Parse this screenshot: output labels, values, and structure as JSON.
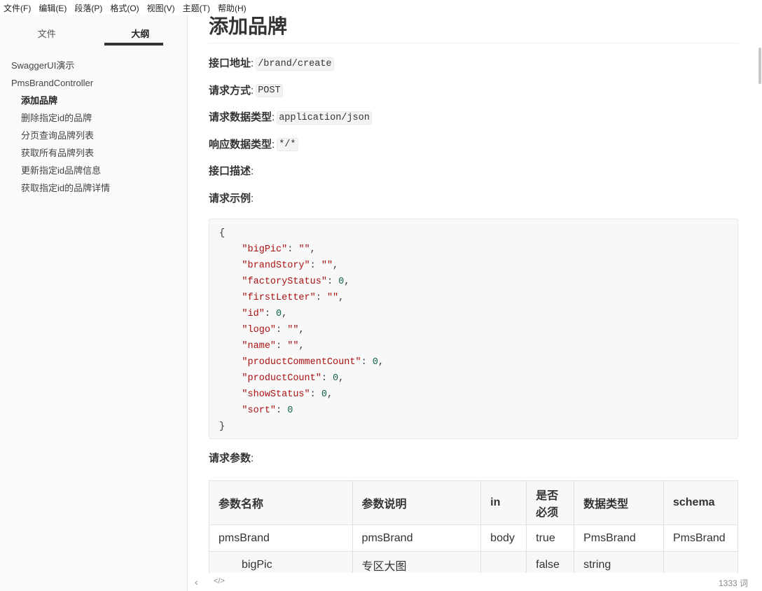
{
  "menu": [
    "文件(F)",
    "编辑(E)",
    "段落(P)",
    "格式(O)",
    "视图(V)",
    "主题(T)",
    "帮助(H)"
  ],
  "sidebar": {
    "tabs": [
      "文件",
      "大纲"
    ],
    "outline": [
      {
        "label": "SwaggerUI演示",
        "level": 1
      },
      {
        "label": "PmsBrandController",
        "level": 1
      },
      {
        "label": "添加品牌",
        "level": 2,
        "active": true
      },
      {
        "label": "删除指定id的品牌",
        "level": 2
      },
      {
        "label": "分页查询品牌列表",
        "level": 2
      },
      {
        "label": "获取所有品牌列表",
        "level": 2
      },
      {
        "label": "更新指定id品牌信息",
        "level": 2
      },
      {
        "label": "获取指定id的品牌详情",
        "level": 2
      }
    ]
  },
  "doc": {
    "title": "添加品牌",
    "fields": [
      {
        "label": "接口地址",
        "code": "/brand/create"
      },
      {
        "label": "请求方式",
        "code": "POST"
      },
      {
        "label": "请求数据类型",
        "code": "application/json"
      },
      {
        "label": "响应数据类型",
        "code": "*/*"
      },
      {
        "label": "接口描述"
      },
      {
        "label": "请求示例"
      }
    ],
    "example": [
      [
        "bigPic",
        "\"\""
      ],
      [
        "brandStory",
        "\"\""
      ],
      [
        "factoryStatus",
        "0"
      ],
      [
        "firstLetter",
        "\"\""
      ],
      [
        "id",
        "0"
      ],
      [
        "logo",
        "\"\""
      ],
      [
        "name",
        "\"\""
      ],
      [
        "productCommentCount",
        "0"
      ],
      [
        "productCount",
        "0"
      ],
      [
        "showStatus",
        "0"
      ],
      [
        "sort",
        "0"
      ]
    ],
    "params_label": "请求参数",
    "table": {
      "headers": [
        "参数名称",
        "参数说明",
        "in",
        "是否必须",
        "数据类型",
        "schema"
      ],
      "rows": [
        [
          "pmsBrand",
          "pmsBrand",
          "body",
          "true",
          "PmsBrand",
          "PmsBrand"
        ],
        [
          "bigPic",
          "专区大图",
          "",
          "false",
          "string",
          ""
        ]
      ]
    }
  },
  "status": {
    "word_count": "1333 词"
  }
}
